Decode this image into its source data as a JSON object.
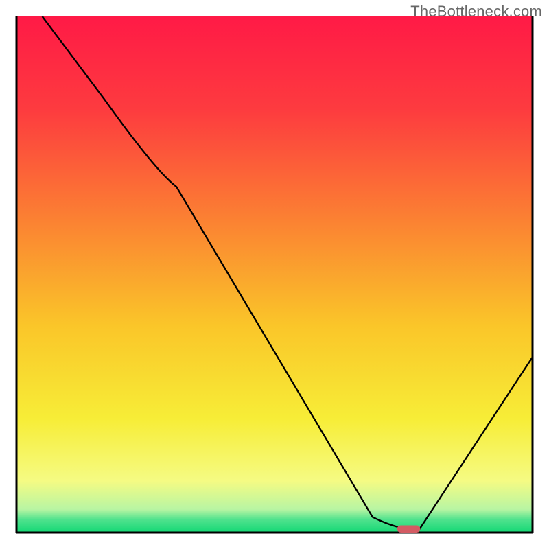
{
  "watermark": "TheBottleneck.com",
  "chart_data": {
    "type": "line",
    "title": "",
    "xlabel": "",
    "ylabel": "",
    "xlim": [
      0,
      100
    ],
    "ylim": [
      0,
      100
    ],
    "axes_visible": false,
    "grid": false,
    "background_gradient": [
      {
        "pos": 0.0,
        "color": "#ff1a46"
      },
      {
        "pos": 0.18,
        "color": "#fd3b3f"
      },
      {
        "pos": 0.4,
        "color": "#fb8332"
      },
      {
        "pos": 0.6,
        "color": "#fac629"
      },
      {
        "pos": 0.78,
        "color": "#f7ed37"
      },
      {
        "pos": 0.9,
        "color": "#f5fb83"
      },
      {
        "pos": 0.955,
        "color": "#b8f5a3"
      },
      {
        "pos": 0.975,
        "color": "#4fe28d"
      },
      {
        "pos": 1.0,
        "color": "#14d875"
      }
    ],
    "series": [
      {
        "name": "bottleneck-curve",
        "x": [
          5,
          17,
          27,
          31,
          69,
          74,
          78,
          100
        ],
        "y": [
          100,
          84,
          70,
          67,
          3,
          0.5,
          0.5,
          34
        ]
      }
    ],
    "marker": {
      "name": "optimal-point",
      "x": 76,
      "y": 0.7,
      "width": 4.5,
      "height": 1.4,
      "color": "#d35b63"
    },
    "border_color": "#000000",
    "border_width": 3
  }
}
